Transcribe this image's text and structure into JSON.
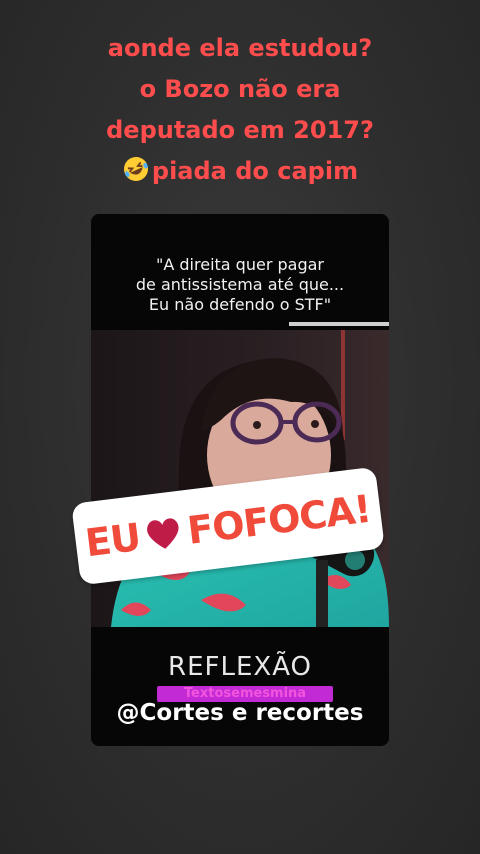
{
  "caption": {
    "lines": [
      "aonde ela estudou?",
      "o Bozo não era",
      "deputado em 2017?",
      "piada do capim"
    ],
    "emoji": "rolling-on-floor-laughing-emoji",
    "color": "#ff4d4d"
  },
  "video": {
    "quote": {
      "lines": [
        "\"A direita quer pagar",
        "de antissistema até  que...",
        "Eu não defendo o STF\""
      ]
    },
    "sticker": {
      "left": "EU",
      "right": "FOFOCA!",
      "icon": "heart-icon",
      "color": "#f04a3a"
    },
    "title": "REFLEXÃO",
    "pink_label": "Textosemesmina",
    "handle": "@Cortes e recortes"
  }
}
